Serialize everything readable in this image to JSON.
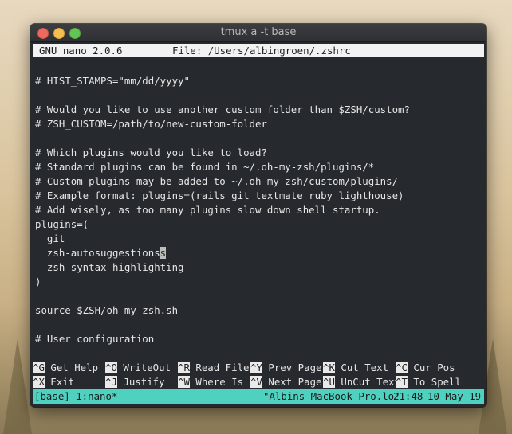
{
  "window": {
    "title": "tmux a -t base"
  },
  "nano": {
    "version": "GNU nano 2.0.6",
    "file_label": "File: /Users/albingroen/.zshrc"
  },
  "editor": {
    "lines": [
      "",
      "# HIST_STAMPS=\"mm/dd/yyyy\"",
      "",
      "# Would you like to use another custom folder than $ZSH/custom?",
      "# ZSH_CUSTOM=/path/to/new-custom-folder",
      "",
      "# Which plugins would you like to load?",
      "# Standard plugins can be found in ~/.oh-my-zsh/plugins/*",
      "# Custom plugins may be added to ~/.oh-my-zsh/custom/plugins/",
      "# Example format: plugins=(rails git textmate ruby lighthouse)",
      "# Add wisely, as too many plugins slow down shell startup.",
      "plugins=(",
      "  git",
      "  zsh-autosuggestions",
      "  zsh-syntax-highlighting",
      ")",
      "",
      "source $ZSH/oh-my-zsh.sh",
      "",
      "# User configuration"
    ],
    "cursor": {
      "line": 13,
      "char": "s"
    }
  },
  "shortcuts": {
    "row1": [
      {
        "key": "^G",
        "label": "Get Help"
      },
      {
        "key": "^O",
        "label": "WriteOut"
      },
      {
        "key": "^R",
        "label": "Read File"
      },
      {
        "key": "^Y",
        "label": "Prev Page"
      },
      {
        "key": "^K",
        "label": "Cut Text"
      },
      {
        "key": "^C",
        "label": "Cur Pos"
      }
    ],
    "row2": [
      {
        "key": "^X",
        "label": "Exit"
      },
      {
        "key": "^J",
        "label": "Justify"
      },
      {
        "key": "^W",
        "label": "Where Is"
      },
      {
        "key": "^V",
        "label": "Next Page"
      },
      {
        "key": "^U",
        "label": "UnCut Text"
      },
      {
        "key": "^T",
        "label": "To Spell"
      }
    ]
  },
  "tmux": {
    "session": "[base] 1:nano*",
    "host": "\"Albins-MacBook-Pro.lo\"",
    "time": "21:48",
    "date": "10-May-19"
  }
}
